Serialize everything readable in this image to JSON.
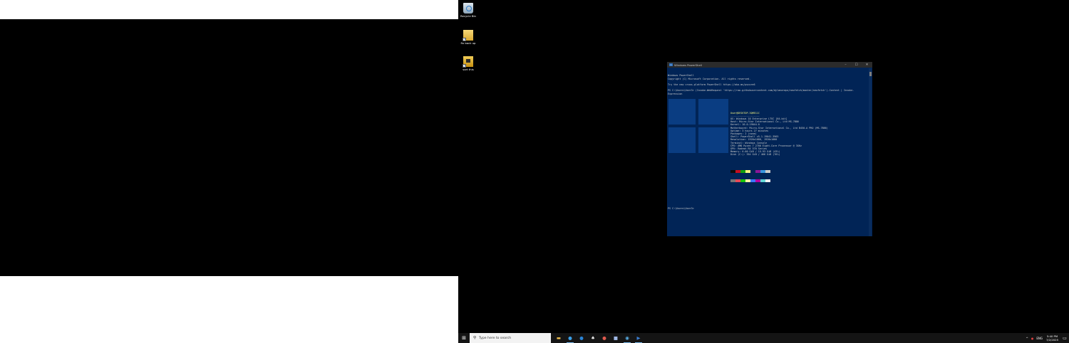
{
  "desktop_icons": [
    {
      "label": "Recycle Bin",
      "icon": "recycle-bin-icon"
    },
    {
      "label": "fix back up",
      "icon": "folder-icon"
    },
    {
      "label": "sort this",
      "icon": "folder-icon"
    }
  ],
  "powershell": {
    "title": "Windows PowerShell",
    "colors": {
      "background": "#012456",
      "text": "#cccccc",
      "highlight": "#f4f482"
    },
    "lines": [
      {
        "text": "Windows PowerShell"
      },
      {
        "text": "Copyright (C) Microsoft Corporation. All rights reserved."
      },
      {
        "text": ""
      },
      {
        "text": "Try the new cross-platform PowerShell https://aka.ms/pscore6"
      },
      {
        "text": ""
      },
      {
        "text": "PS C:\\Users\\User3> (Invoke-WebRequest 'https://raw.githubusercontent.com/dylanaraps/neofetch/master/neofetch').Content | Invoke-Expression"
      }
    ],
    "sysinfo": [
      "User@DESKTOP-3QME11C",
      "--------------------",
      "OS: Windows 10 Enterprise LTSC [64-bit]",
      "Host: Micro-Star International Co., Ltd MS-7B86",
      "Kernel: 10.0.19044.0",
      "Motherboard: Micro-Star International Co., Ltd B450-A PRO (MS-7B86)",
      "Uptime: 3 hours 27 minutes",
      "Packages: 2 (none)",
      "Shell: PowerShell v5.1.19041.3965",
      "Resolution: 1920x1080, 1920x1080",
      "Terminal: Windows Console",
      "CPU: AMD Ryzen 7 2700 Eight-Core Processor @ 3GHz",
      "GPU: Radeon RX 570 Series",
      "Memory: 6.00 GiB / 15.93 GiB (43%)",
      "Disk (C:): 354 GiB / 466 GiB (76%)"
    ],
    "prompt": "PS C:\\Users\\User3>"
  },
  "taskbar": {
    "search_placeholder": "Type here to search",
    "apps": [
      {
        "name": "file-explorer",
        "icon": "folder-icon",
        "glyph": "▬",
        "color": "#f2c14e",
        "open": false
      },
      {
        "name": "edge",
        "icon": "edge-icon",
        "glyph": "●",
        "color": "#3aa0e8",
        "open": true
      },
      {
        "name": "ie",
        "icon": "browser-icon",
        "glyph": "●",
        "color": "#2a84d6",
        "open": false
      },
      {
        "name": "app-a",
        "icon": "app-icon",
        "glyph": "♠",
        "color": "#e8e8e8",
        "open": false
      },
      {
        "name": "chrome",
        "icon": "chrome-icon",
        "glyph": "●",
        "color": "#e05a4e",
        "open": false
      },
      {
        "name": "app-b",
        "icon": "notepad-icon",
        "glyph": "■",
        "color": "#9fb8e6",
        "open": false
      },
      {
        "name": "network",
        "icon": "network-icon",
        "glyph": "◉",
        "color": "#5ab0e8",
        "open": true
      },
      {
        "name": "powershell",
        "icon": "powershell-icon",
        "glyph": "▶",
        "color": "#3b7ed0",
        "open": true
      }
    ],
    "tray": {
      "language": "ENG",
      "time": "5:40 PM",
      "date": "7/2/2025"
    }
  }
}
